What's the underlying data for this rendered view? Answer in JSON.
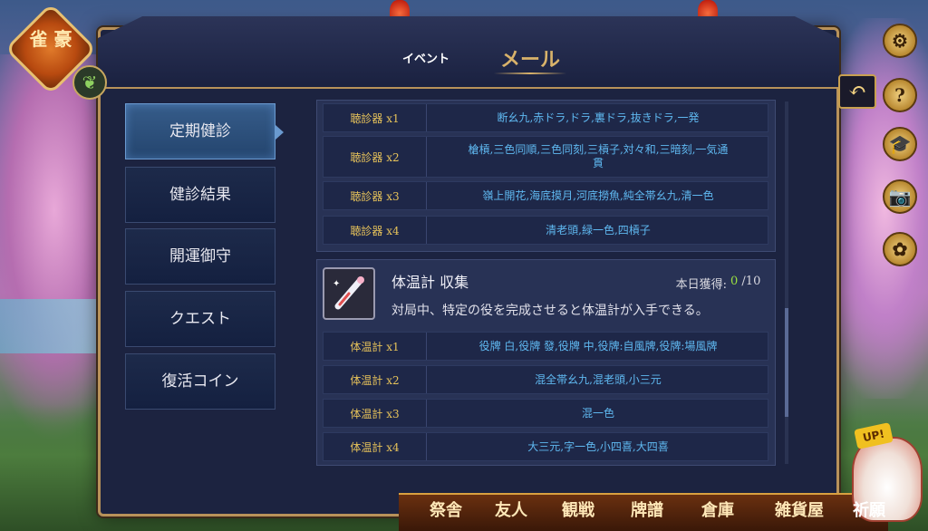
{
  "header": {
    "tab_event": "イベント",
    "tab_mail": "メール"
  },
  "emblem": {
    "text": "雀 豪"
  },
  "menu": [
    {
      "label": "定期健診",
      "active": true
    },
    {
      "label": "健診結果",
      "active": false
    },
    {
      "label": "開運御守",
      "active": false
    },
    {
      "label": "クエスト",
      "active": false
    },
    {
      "label": "復活コイン",
      "active": false
    }
  ],
  "stethoscope_rows": [
    {
      "label": "聴診器 x1",
      "value": "断幺九,赤ドラ,ドラ,裏ドラ,抜きドラ,一発"
    },
    {
      "label": "聴診器 x2",
      "value": "槍槓,三色同順,三色同刻,三槓子,対々和,三暗刻,一気通貫"
    },
    {
      "label": "聴診器 x3",
      "value": "嶺上開花,海底摸月,河底撈魚,純全帯幺九,清一色"
    },
    {
      "label": "聴診器 x4",
      "value": "清老頭,緑一色,四槓子"
    }
  ],
  "thermometer": {
    "title": "体温計 収集",
    "daily_label": "本日獲得:",
    "daily_current": "0",
    "daily_max": "/10",
    "description": "対局中、特定の役を完成させると体温計が入手できる。",
    "icon": "thermometer-icon"
  },
  "thermometer_rows": [
    {
      "label": "体温計 x1",
      "value": "役牌 白,役牌 發,役牌 中,役牌:自風牌,役牌:場風牌"
    },
    {
      "label": "体温計 x2",
      "value": "混全帯幺九,混老頭,小三元"
    },
    {
      "label": "体温計 x3",
      "value": "混一色"
    },
    {
      "label": "体温計 x4",
      "value": "大三元,字一色,小四喜,大四喜"
    }
  ],
  "side_buttons": [
    "gear-icon",
    "help-icon",
    "graduation-cap-icon",
    "camera-icon",
    "badge-icon"
  ],
  "side_button_glyphs": [
    "⚙",
    "?",
    "🎓",
    "📷",
    "✿"
  ],
  "back_glyph": "↶",
  "bottom_nav": [
    {
      "label": "祭舎"
    },
    {
      "label": "友人"
    },
    {
      "label": "観戦"
    },
    {
      "label": "牌譜"
    },
    {
      "label": "倉庫"
    },
    {
      "label": "雑貨屋"
    },
    {
      "label": "祈願"
    }
  ],
  "mascot_badge": "UP!",
  "colors": {
    "accent_gold": "#e6c25a",
    "value_blue": "#5fb8f0",
    "count_green": "#9ae040",
    "panel_bg": "#1c2340"
  }
}
